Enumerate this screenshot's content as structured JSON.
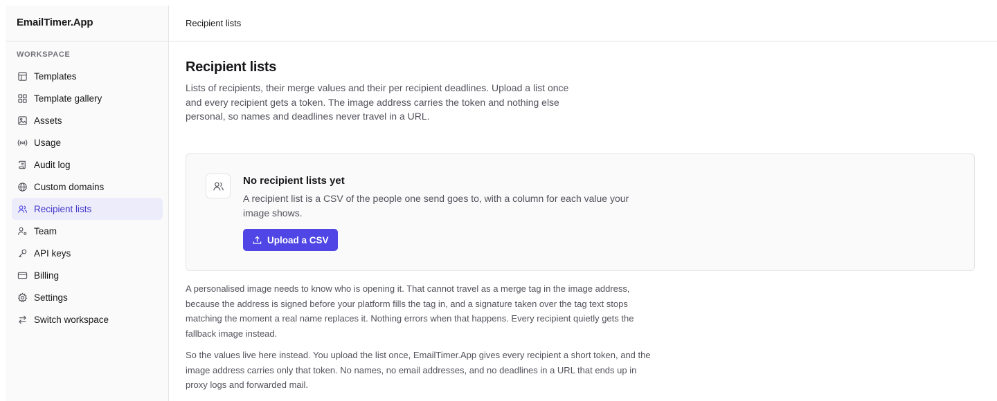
{
  "sidebar": {
    "brand": "EmailTimer.App",
    "section_label": "WORKSPACE",
    "items": [
      {
        "label": "Templates",
        "icon": "table-icon"
      },
      {
        "label": "Template gallery",
        "icon": "grid-icon"
      },
      {
        "label": "Assets",
        "icon": "image-icon"
      },
      {
        "label": "Usage",
        "icon": "broadcast-icon"
      },
      {
        "label": "Audit log",
        "icon": "scroll-icon"
      },
      {
        "label": "Custom domains",
        "icon": "globe-icon"
      },
      {
        "label": "Recipient lists",
        "icon": "users-icon",
        "active": true
      },
      {
        "label": "Team",
        "icon": "user-cog-icon"
      },
      {
        "label": "API keys",
        "icon": "key-icon"
      },
      {
        "label": "Billing",
        "icon": "credit-card-icon"
      },
      {
        "label": "Settings",
        "icon": "gear-icon"
      },
      {
        "label": "Switch workspace",
        "icon": "swap-icon"
      }
    ]
  },
  "header": {
    "breadcrumb": "Recipient lists"
  },
  "main": {
    "title": "Recipient lists",
    "description": "Lists of recipients, their merge values and their per recipient deadlines. Upload a list once and every recipient gets a token. The image address carries the token and nothing else personal, so names and deadlines never travel in a URL.",
    "empty_state": {
      "title": "No recipient lists yet",
      "description": "A recipient list is a CSV of the people one send goes to, with a column for each value your image shows.",
      "button_label": "Upload a CSV"
    },
    "paragraphs": [
      "A personalised image needs to know who is opening it. That cannot travel as a merge tag in the image address, because the address is signed before your platform fills the tag in, and a signature taken over the tag text stops matching the moment a real name replaces it. Nothing errors when that happens. Every recipient quietly gets the fallback image instead.",
      "So the values live here instead. You upload the list once, EmailTimer.App gives every recipient a short token, and the image address carries only that token. No names, no email addresses, and no deadlines in a URL that ends up in proxy logs and forwarded mail."
    ]
  },
  "colors": {
    "accent": "#4f46e5",
    "active_bg": "#ececfb",
    "active_text": "#4338ca"
  }
}
